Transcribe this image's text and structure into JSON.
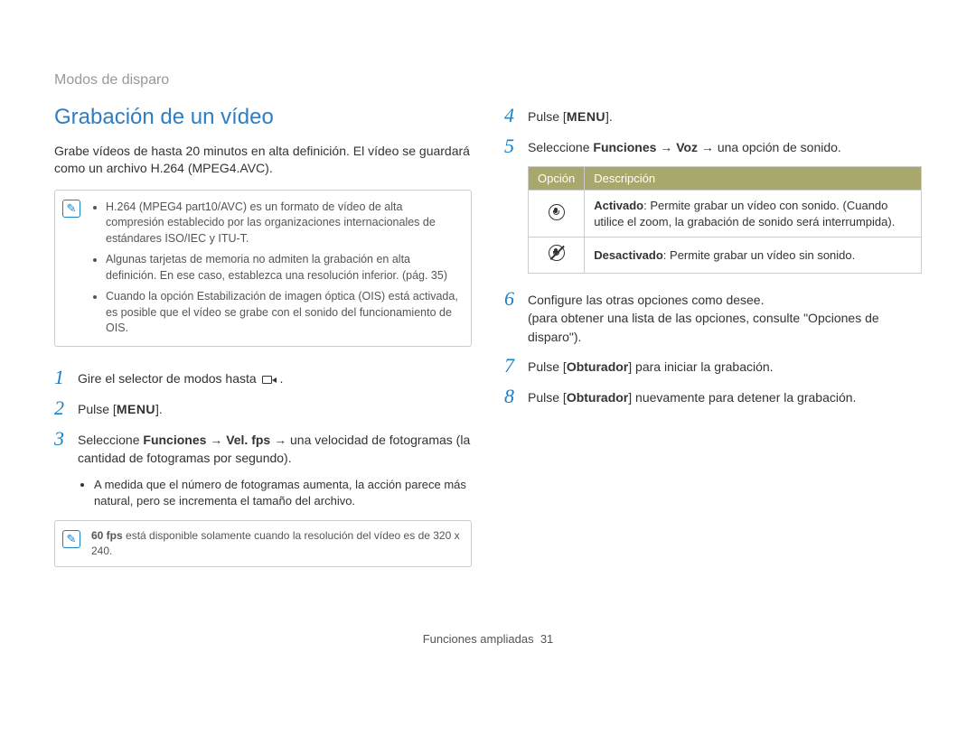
{
  "breadcrumb": "Modos de disparo",
  "title": "Grabación de un vídeo",
  "intro": "Grabe vídeos de hasta 20 minutos en alta definición. El vídeo se guardará como un archivo H.264 (MPEG4.AVC).",
  "notes_main": [
    "H.264 (MPEG4 part10/AVC) es un formato de vídeo de alta compresión establecido por las organizaciones internacionales de estándares ISO/IEC y ITU-T.",
    "Algunas tarjetas de memoria no admiten la grabación en alta definición. En ese caso, establezca una resolución inferior. (pág. 35)",
    "Cuando la opción Estabilización de imagen óptica (OIS) está activada, es posible que el vídeo se grabe con el sonido del funcionamiento de OIS."
  ],
  "left_steps": {
    "s1": {
      "num": "1",
      "pre": "Gire el selector de modos hasta ",
      "post": "."
    },
    "s2": {
      "num": "2",
      "pre": "Pulse [",
      "menu": "MENU",
      "post": "]."
    },
    "s3": {
      "num": "3",
      "pre": "Seleccione ",
      "b1": "Funciones",
      "arrow": " → ",
      "b2": "Vel. fps",
      "post": " → una velocidad de fotogramas (la cantidad de fotogramas por segundo).",
      "bullet": "A medida que el número de fotogramas aumenta, la acción parece más natural, pero se incrementa el tamaño del archivo."
    }
  },
  "note_60fps": {
    "b": "60 fps",
    "text": " está disponible solamente cuando la resolución del vídeo es de 320 x 240."
  },
  "right_steps": {
    "s4": {
      "num": "4",
      "pre": "Pulse [",
      "menu": "MENU",
      "post": "]."
    },
    "s5": {
      "num": "5",
      "pre": "Seleccione ",
      "b1": "Funciones",
      "arrow": " → ",
      "b2": "Voz",
      "post": " → una opción de sonido."
    },
    "s6": {
      "num": "6",
      "l1": "Configure las otras opciones como desee.",
      "l2": "(para obtener una lista de las opciones, consulte \"Opciones de disparo\")."
    },
    "s7": {
      "num": "7",
      "pre": "Pulse [",
      "b": "Obturador",
      "post": "] para iniciar la grabación."
    },
    "s8": {
      "num": "8",
      "pre": "Pulse [",
      "b": "Obturador",
      "post": "] nuevamente para detener la grabación."
    }
  },
  "options_table": {
    "h1": "Opción",
    "h2": "Descripción",
    "row1": {
      "b": "Activado",
      "text": ": Permite grabar un vídeo con sonido. (Cuando utilice el zoom, la grabación de sonido será interrumpida)."
    },
    "row2": {
      "b": "Desactivado",
      "text": ": Permite grabar un vídeo sin sonido."
    }
  },
  "footer": {
    "label": "Funciones ampliadas",
    "page": "31"
  }
}
